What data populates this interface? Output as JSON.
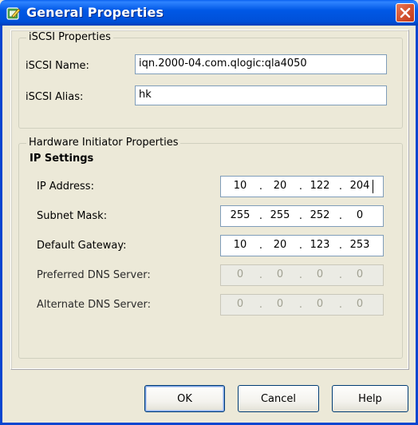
{
  "window": {
    "title": "General Properties",
    "icon": "edit-properties-icon",
    "close_icon": "close-icon"
  },
  "iscsi": {
    "legend": "iSCSI Properties",
    "name_label": "iSCSI Name:",
    "name_value": "iqn.2000-04.com.qlogic:qla4050",
    "alias_label": "iSCSI Alias:",
    "alias_value": "hk"
  },
  "hardware": {
    "legend": "Hardware Initiator Properties",
    "ip_settings_heading": "IP Settings",
    "fields": [
      {
        "label": "IP Address:",
        "octets": [
          "10",
          "20",
          "122",
          "204"
        ],
        "enabled": true,
        "focused": true
      },
      {
        "label": "Subnet Mask:",
        "octets": [
          "255",
          "255",
          "252",
          "0"
        ],
        "enabled": true
      },
      {
        "label": "Default Gateway:",
        "octets": [
          "10",
          "20",
          "123",
          "253"
        ],
        "enabled": true
      },
      {
        "label": "Preferred DNS Server:",
        "octets": [
          "0",
          "0",
          "0",
          "0"
        ],
        "enabled": false
      },
      {
        "label": "Alternate DNS Server:",
        "octets": [
          "0",
          "0",
          "0",
          "0"
        ],
        "enabled": false
      }
    ],
    "separator": "."
  },
  "buttons": {
    "ok": "OK",
    "cancel": "Cancel",
    "help": "Help"
  },
  "colors": {
    "titlebar": "#0058e6",
    "dialog_bg": "#ece9d8",
    "close_button": "#d4532f"
  }
}
